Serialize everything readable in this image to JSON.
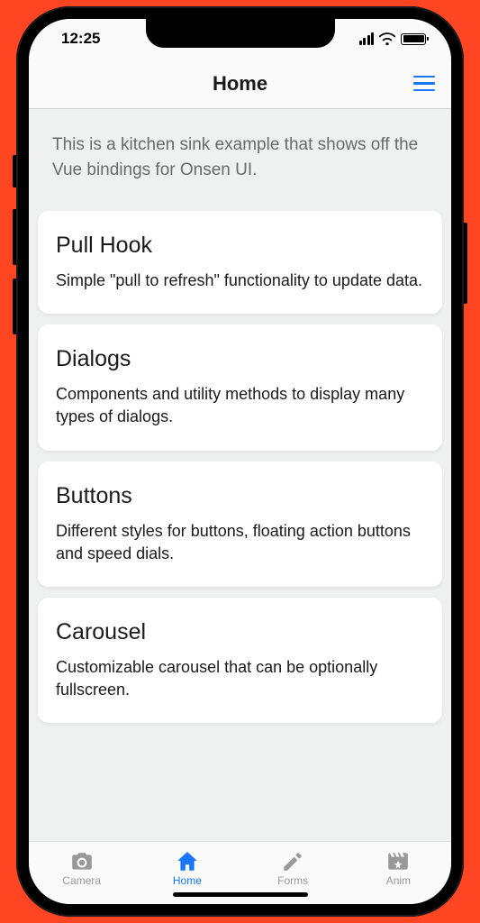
{
  "status": {
    "time": "12:25"
  },
  "toolbar": {
    "title": "Home"
  },
  "intro": "This is a kitchen sink example that shows off the Vue bindings for Onsen UI.",
  "cards": [
    {
      "title": "Pull Hook",
      "desc": "Simple \"pull to refresh\" functionality to update data."
    },
    {
      "title": "Dialogs",
      "desc": "Components and utility methods to display many types of dialogs."
    },
    {
      "title": "Buttons",
      "desc": "Different styles for buttons, floating action buttons and speed dials."
    },
    {
      "title": "Carousel",
      "desc": "Customizable carousel that can be optionally fullscreen."
    }
  ],
  "tabs": [
    {
      "label": "Camera",
      "icon": "camera",
      "active": false
    },
    {
      "label": "Home",
      "icon": "home",
      "active": true
    },
    {
      "label": "Forms",
      "icon": "pencil",
      "active": false
    },
    {
      "label": "Anim",
      "icon": "film",
      "active": false
    }
  ],
  "colors": {
    "accent": "#1876ff",
    "page_bg": "#ff4521"
  }
}
